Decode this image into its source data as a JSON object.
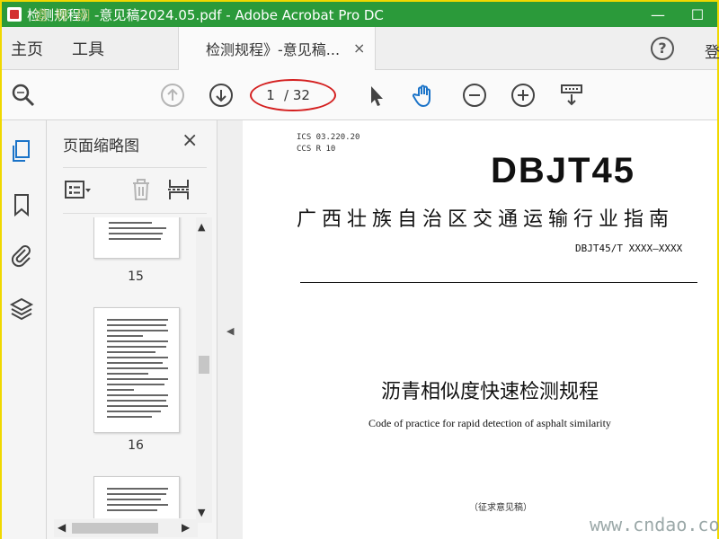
{
  "window": {
    "title": "检测规程》-意见稿2024.05.pdf - Adobe Acrobat Pro DC",
    "minimize": "—",
    "maximize": "☐",
    "watermark": "道 称 网"
  },
  "menu": {
    "home": "主页",
    "tools": "工具",
    "doc_tab": "检测规程》-意见稿...",
    "tab_close": "×",
    "help": "?",
    "login": "登"
  },
  "toolbar": {
    "current_page": "1",
    "total_pages": "/ 32",
    "accent": "#1a73c8",
    "highlight": "#d42020"
  },
  "thumbnails_panel": {
    "title": "页面缩略图",
    "close": "×",
    "pages": [
      {
        "number": "15"
      },
      {
        "number": "16"
      }
    ]
  },
  "document": {
    "ics": "ICS  03.220.20",
    "ccs": "CCS  R 10",
    "code": "DBJT45",
    "organization": "广西壮族自治区交通运输行业指南",
    "standard_number": "DBJT45/T XXXX—XXXX",
    "title_cn": "沥青相似度快速检测规程",
    "title_en": "Code of practice for rapid detection of asphalt similarity",
    "draft_note": "（征求意见稿）"
  },
  "watermark_bottom": "www.cndao.com"
}
